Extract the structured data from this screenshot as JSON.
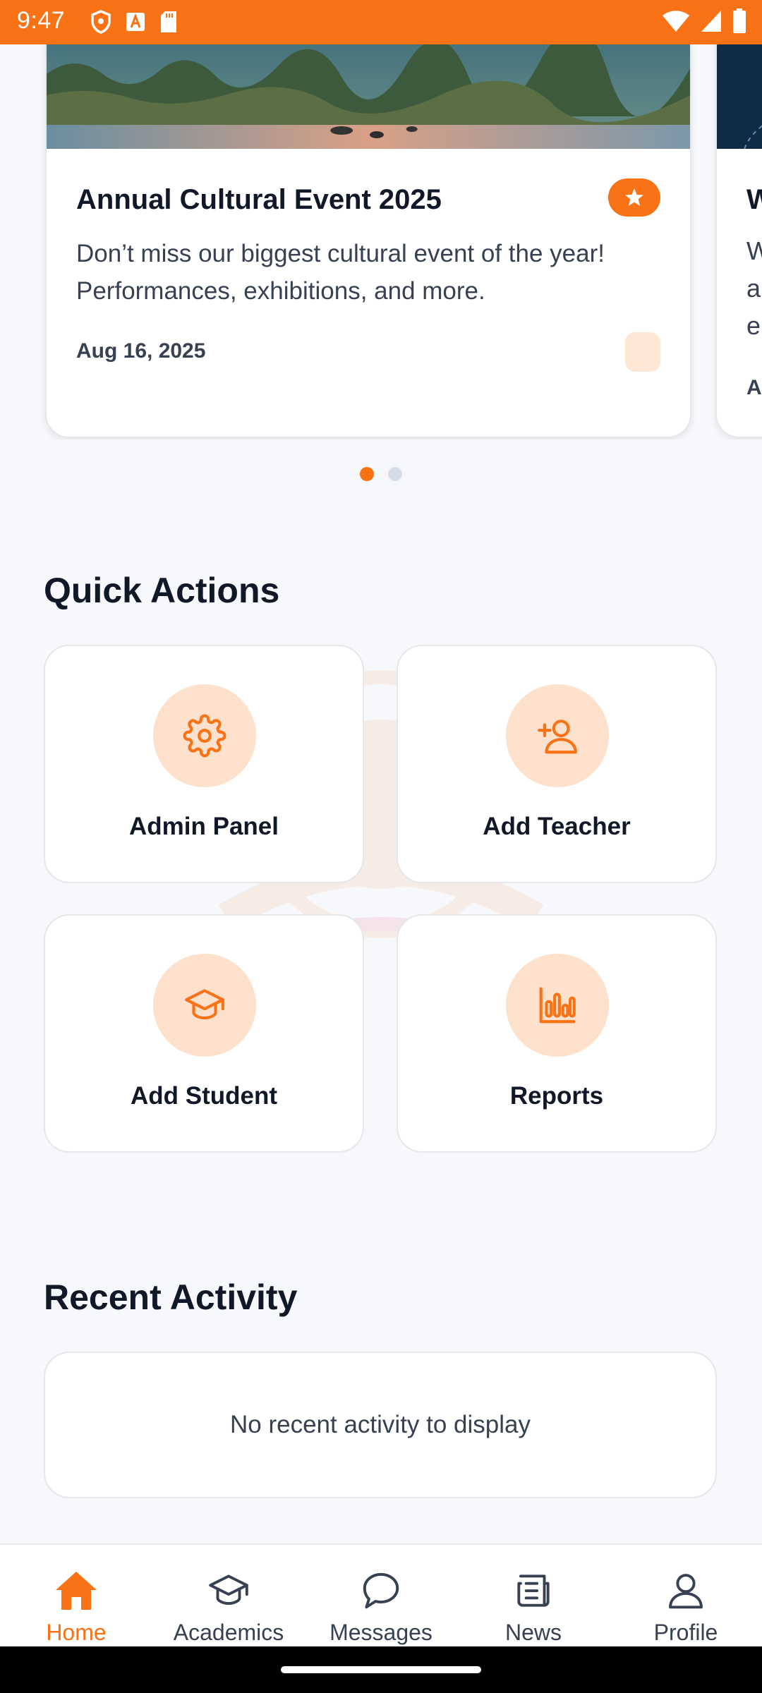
{
  "status_bar": {
    "time": "9:47",
    "left_icons": [
      "shield-icon",
      "font-a-icon",
      "sd-card-icon"
    ],
    "right_icons": [
      "wifi-icon",
      "signal-icon",
      "battery-icon"
    ]
  },
  "carousel": {
    "cards": [
      {
        "title": "Annual Cultural Event 2025",
        "description": "Don’t miss our biggest cultural event of the year! Performances, exhibitions, and more.",
        "date": "Aug 16, 2025",
        "badge_icon": "star-icon"
      },
      {
        "title_fragment": "W",
        "desc_fragments": [
          "W",
          "a",
          "e"
        ],
        "date_fragment": "A"
      }
    ],
    "active_index": 0,
    "page_count": 2
  },
  "quick_actions": {
    "title": "Quick Actions",
    "items": [
      {
        "label": "Admin Panel",
        "icon": "gear-icon"
      },
      {
        "label": "Add Teacher",
        "icon": "add-user-icon"
      },
      {
        "label": "Add Student",
        "icon": "graduation-cap-icon"
      },
      {
        "label": "Reports",
        "icon": "bar-chart-icon"
      }
    ]
  },
  "recent_activity": {
    "title": "Recent Activity",
    "empty_text": "No recent activity to display"
  },
  "bottom_nav": {
    "items": [
      {
        "label": "Home",
        "icon": "home-icon",
        "active": true
      },
      {
        "label": "Academics",
        "icon": "graduation-cap-icon",
        "active": false
      },
      {
        "label": "Messages",
        "icon": "chat-bubble-icon",
        "active": false
      },
      {
        "label": "News",
        "icon": "newspaper-icon",
        "active": false
      },
      {
        "label": "Profile",
        "icon": "person-icon",
        "active": false
      }
    ]
  },
  "colors": {
    "accent": "#f97316",
    "accent_soft": "#fde1cd",
    "background": "#f7f8fb",
    "text_primary": "#111827",
    "text_secondary": "#374151"
  }
}
